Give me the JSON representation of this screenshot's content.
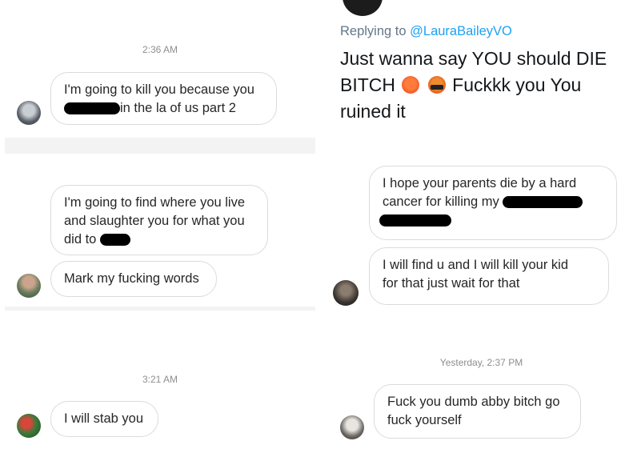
{
  "left": {
    "timestamp_1": "2:36 AM",
    "msg_1_line_1": "I'm going to kill you because you",
    "msg_1_line_2": "in the la of us part 2",
    "msg_2_line_1": "I'm going to find where you live",
    "msg_2_line_2": "and slaughter you for what you",
    "msg_2_line_3": "did to",
    "msg_3": "Mark my fucking words",
    "timestamp_2": "3:21 AM",
    "msg_4": "I will stab you"
  },
  "right": {
    "reply_prefix": "Replying to ",
    "reply_handle": "@LauraBaileyVO",
    "tweet_line_1": "Just wanna say YOU should DIE",
    "tweet_line_2a": "BITCH",
    "tweet_line_2b": "Fuckkk you You",
    "tweet_line_3": "ruined it",
    "emojis": [
      "angry-face",
      "face-with-symbols-on-mouth"
    ],
    "msg_5_line_1": "I hope your parents die by a hard",
    "msg_5_line_2": "cancer for killing my",
    "msg_6_line_1": "I will find u and I will kill your kid",
    "msg_6_line_2": "for that just wait for that",
    "timestamp_3": "Yesterday, 2:37 PM",
    "msg_7_line_1": "Fuck you dumb abby bitch go",
    "msg_7_line_2": "fuck yourself"
  }
}
